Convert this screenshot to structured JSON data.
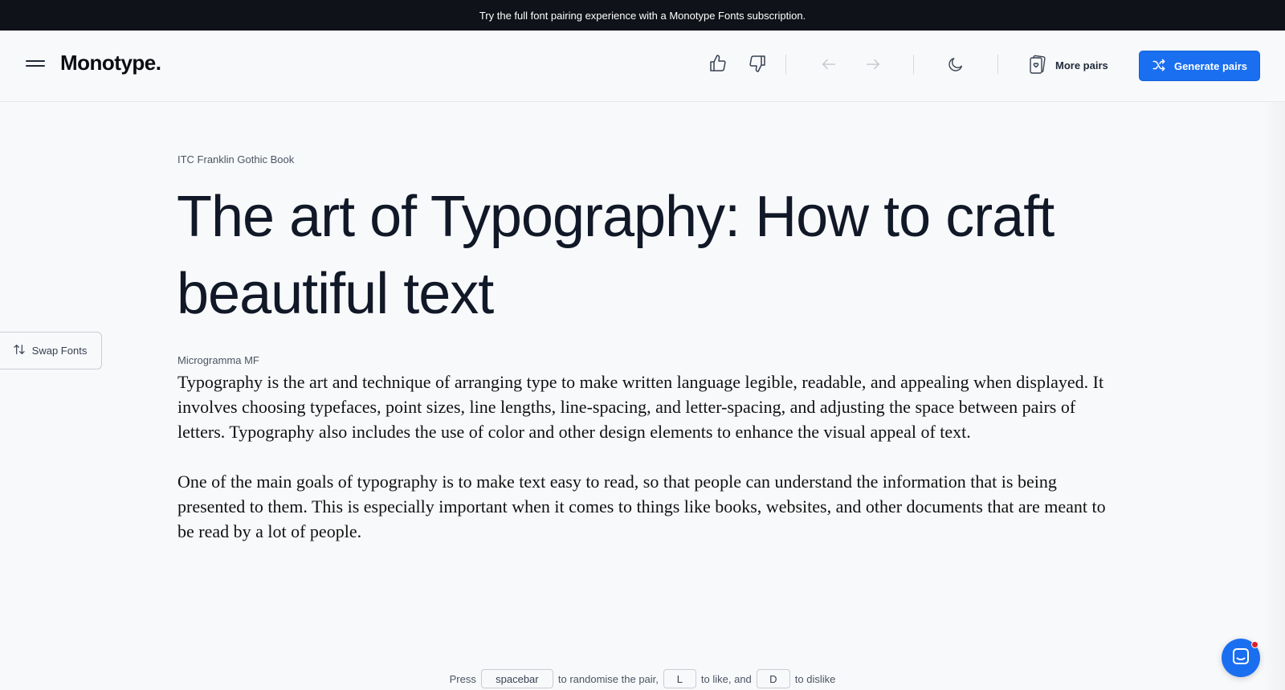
{
  "banner": {
    "text": "Try the full font pairing experience with a Monotype Fonts subscription."
  },
  "header": {
    "logo": "Monotype.",
    "icons": [
      "hamburger-menu-icon",
      "thumbs-up-icon",
      "thumbs-down-icon",
      "arrow-left-icon",
      "arrow-right-icon",
      "moon-icon",
      "cards-icon",
      "shuffle-icon"
    ],
    "more_pairs_label": "More pairs",
    "generate_label": "Generate pairs"
  },
  "main": {
    "heading_font": "ITC Franklin Gothic Book",
    "headline": "The art of Typography: How to craft beautiful text",
    "body_font": "Microgramma MF",
    "paragraphs": [
      "Typography is the art and technique of arranging type to make written language legible, readable, and appealing when displayed. It involves choosing typefaces, point sizes, line lengths, line-spacing, and letter-spacing, and adjusting the space between pairs of letters. Typography also includes the use of color and other design elements to enhance the visual appeal of text.",
      "One of the main goals of typography is to make text easy to read, so that people can understand the information that is being presented to them. This is especially important when it comes to things like books, websites, and other documents that are meant to be read by a lot of people."
    ]
  },
  "swap": {
    "label": "Swap Fonts"
  },
  "footer": {
    "press": "Press",
    "spacebar": "spacebar",
    "randomise": "to randomise the pair,",
    "like_key": "L",
    "to_like": "to like, and",
    "dislike_key": "D",
    "to_dislike": "to dislike"
  },
  "colors": {
    "accent": "#1a6ff0",
    "banner_bg": "#0f1218",
    "page_bg": "#f8f9fb",
    "notification": "#e11d2a"
  }
}
